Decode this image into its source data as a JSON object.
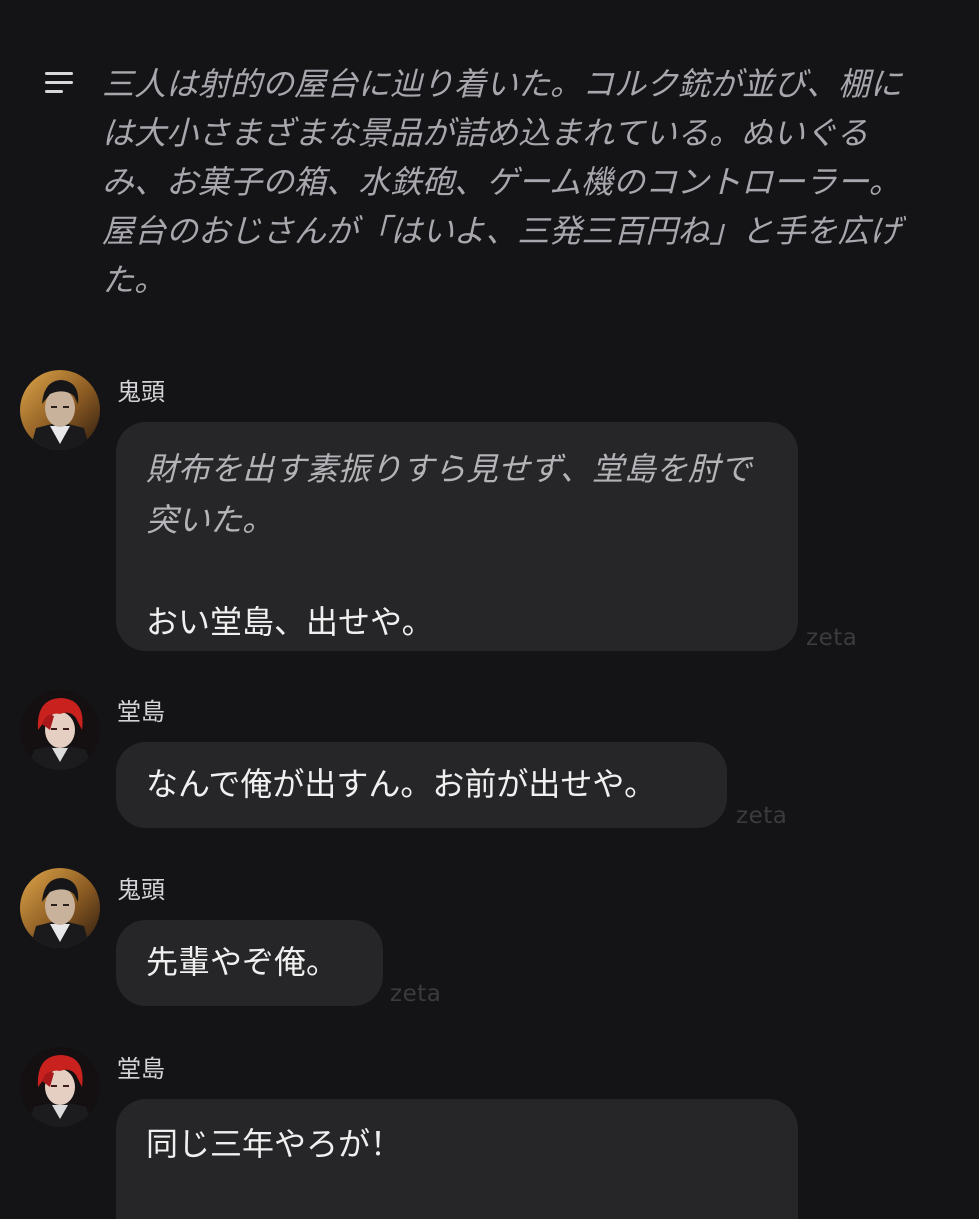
{
  "narration": {
    "icon": "menu-lines-icon",
    "text": "三人は射的の屋台に辿り着いた。コルク銃が並び、棚には大小さまざまな景品が詰め込まれている。ぬいぐるみ、お菓子の箱、水鉄砲、ゲーム機のコントローラー。屋台のおじさんが「はいよ、三発三百円ね」と手を広げた。"
  },
  "messages": [
    {
      "sender": "鬼頭",
      "avatar": "kitou-avatar",
      "action": "財布を出す素振りすら見せず、堂島を肘で突いた。",
      "text": "おい堂島、出せや。",
      "watermark": "zeta"
    },
    {
      "sender": "堂島",
      "avatar": "dojima-avatar",
      "text": "なんで俺が出すん。お前が出せや。",
      "watermark": "zeta"
    },
    {
      "sender": "鬼頭",
      "avatar": "kitou-avatar",
      "text": "先輩やぞ俺。",
      "watermark": "zeta"
    },
    {
      "sender": "堂島",
      "avatar": "dojima-avatar",
      "text": "同じ三年やろが！"
    }
  ],
  "colors": {
    "background": "#141416",
    "bubble": "#262628",
    "narration_text": "#a7a7ad",
    "watermark": "#3b3b3f"
  }
}
